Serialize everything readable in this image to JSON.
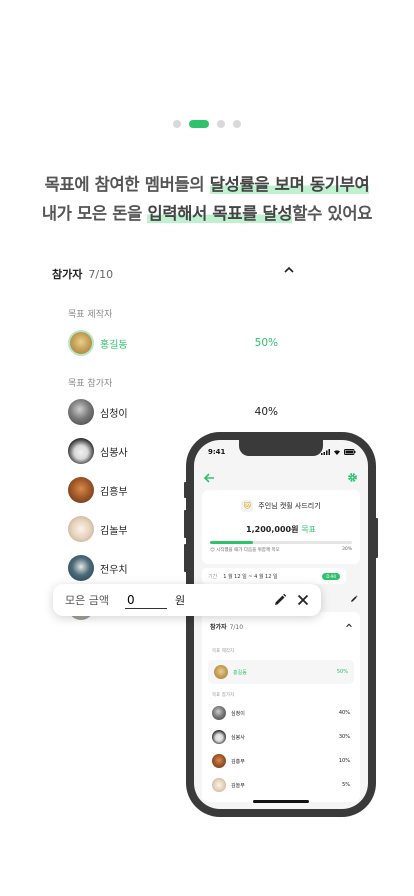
{
  "pager": {
    "count": 4,
    "active_index": 1
  },
  "headline": {
    "line1_a": "목표에 참여한 멤버들의 ",
    "line1_hl": "달성률을 보며 동기부여",
    "line2_a": "내가 모은 돈을 ",
    "line2_hl": "입력해서 목표를 달성",
    "line2_b": "할수 있어요"
  },
  "participants": {
    "title": "참가자",
    "count": "7/10",
    "creator_label": "목표 제작자",
    "member_label": "목표 참가자",
    "creator": {
      "name": "홍길동",
      "percent": "50%"
    },
    "members": [
      {
        "name": "심청이",
        "percent": "40%"
      },
      {
        "name": "심봉사",
        "percent": ""
      },
      {
        "name": "김흥부",
        "percent": ""
      },
      {
        "name": "김놀부",
        "percent": ""
      },
      {
        "name": "전우치",
        "percent": ""
      }
    ]
  },
  "amount_card": {
    "label": "모은 금액",
    "value": "0",
    "unit": "원"
  },
  "phone": {
    "time": "9:41",
    "goal_emoji": "🐱",
    "goal_title": "주인님 캣휠 사드리기",
    "goal_amount": "1,200,000원",
    "goal_amount_suffix": "목표",
    "progress_fraction": 0.3,
    "progress_caption": "😊 시작했을 때가 다음을 위함께 목모",
    "progress_percent": "30%",
    "period_label": "기간",
    "period_dates": "1 월 12 일  ~  4 월 12 일",
    "period_badge": "D-90",
    "participants_title": "참가자",
    "participants_count": "7/10",
    "creator_label": "목표 제작자",
    "member_label": "목표 참가자",
    "creator": {
      "name": "홍길동",
      "percent": "50%"
    },
    "members": [
      {
        "name": "심청이",
        "percent": "40%"
      },
      {
        "name": "심봉사",
        "percent": "30%"
      },
      {
        "name": "김흥부",
        "percent": "10%"
      },
      {
        "name": "김놀부",
        "percent": "5%"
      }
    ]
  },
  "colors": {
    "accent": "#2ec36b",
    "highlight": "#bff0cf",
    "phone_frame": "#3a3a3a"
  },
  "icons": [
    "pencil-icon",
    "close-icon",
    "chevron-up-icon",
    "back-arrow-icon",
    "gear-icon"
  ]
}
